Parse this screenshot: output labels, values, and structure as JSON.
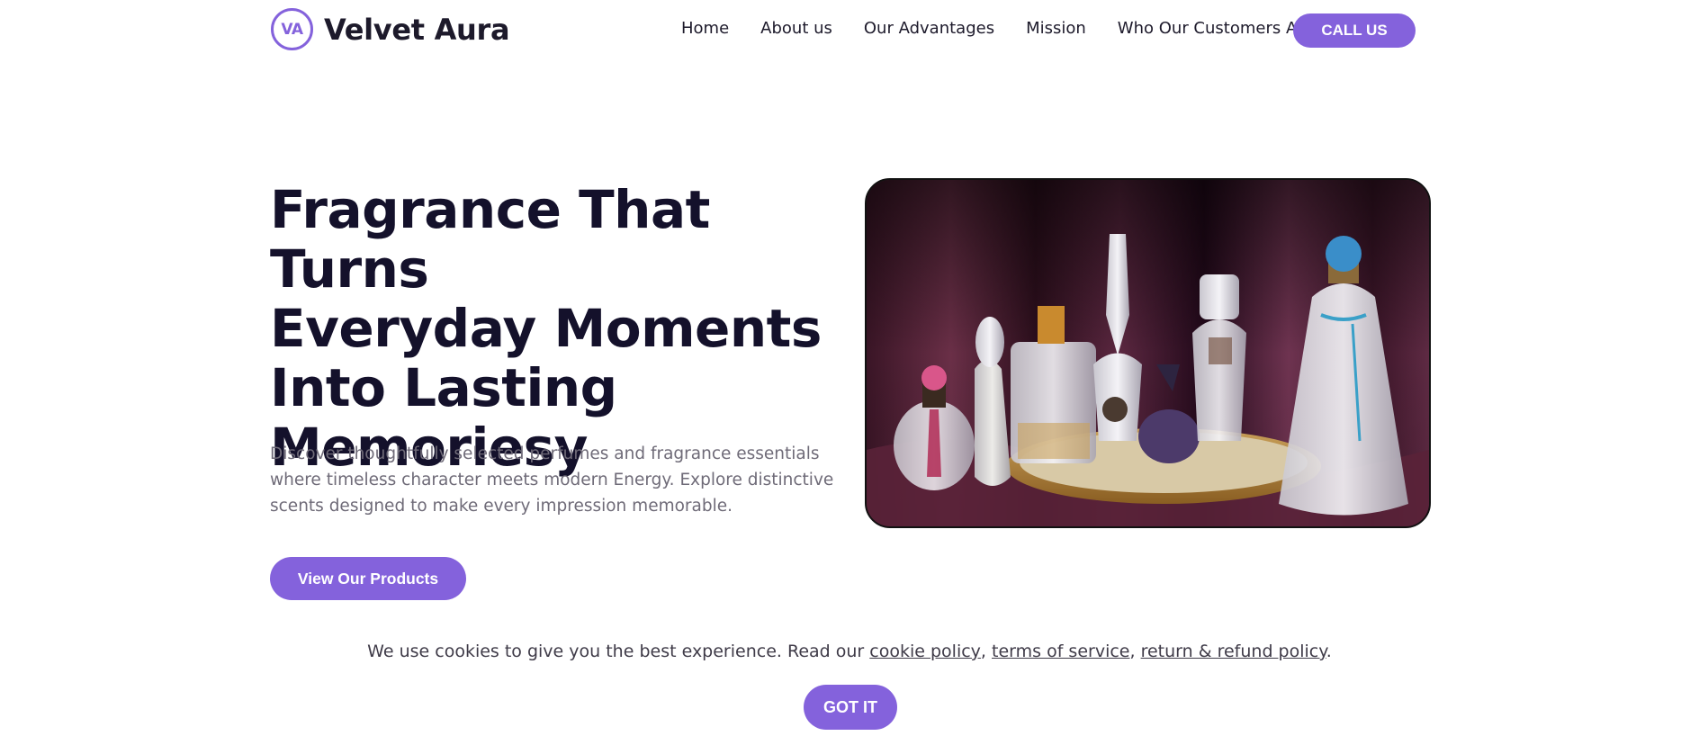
{
  "brand": {
    "logo_initials": "VA",
    "name": "Velvet Aura"
  },
  "nav": {
    "items": [
      "Home",
      "About us",
      "Our Advantages",
      "Mission",
      "Who Our Customers Are"
    ],
    "cta": "CALL US"
  },
  "hero": {
    "title_lines": [
      "Fragrance That Turns",
      "Everyday Moments",
      "Into Lasting",
      "Memoriesy"
    ],
    "description": "Discover thoughtfully selected perfumes and fragrance essentials where timeless character meets modern Energy. Explore distinctive scents designed to make every impression memorable.",
    "button": "View Our Products"
  },
  "cookie": {
    "text_before": "We use cookies to give you the best experience. Read our ",
    "link1": "cookie policy",
    "sep1": ", ",
    "link2": "terms of service",
    "sep2": ", ",
    "link3": "return & refund policy",
    "text_after": ".",
    "button": "GOT IT"
  },
  "colors": {
    "accent": "#8462dc",
    "heading": "#14112b",
    "body_text": "#6f6b78"
  }
}
